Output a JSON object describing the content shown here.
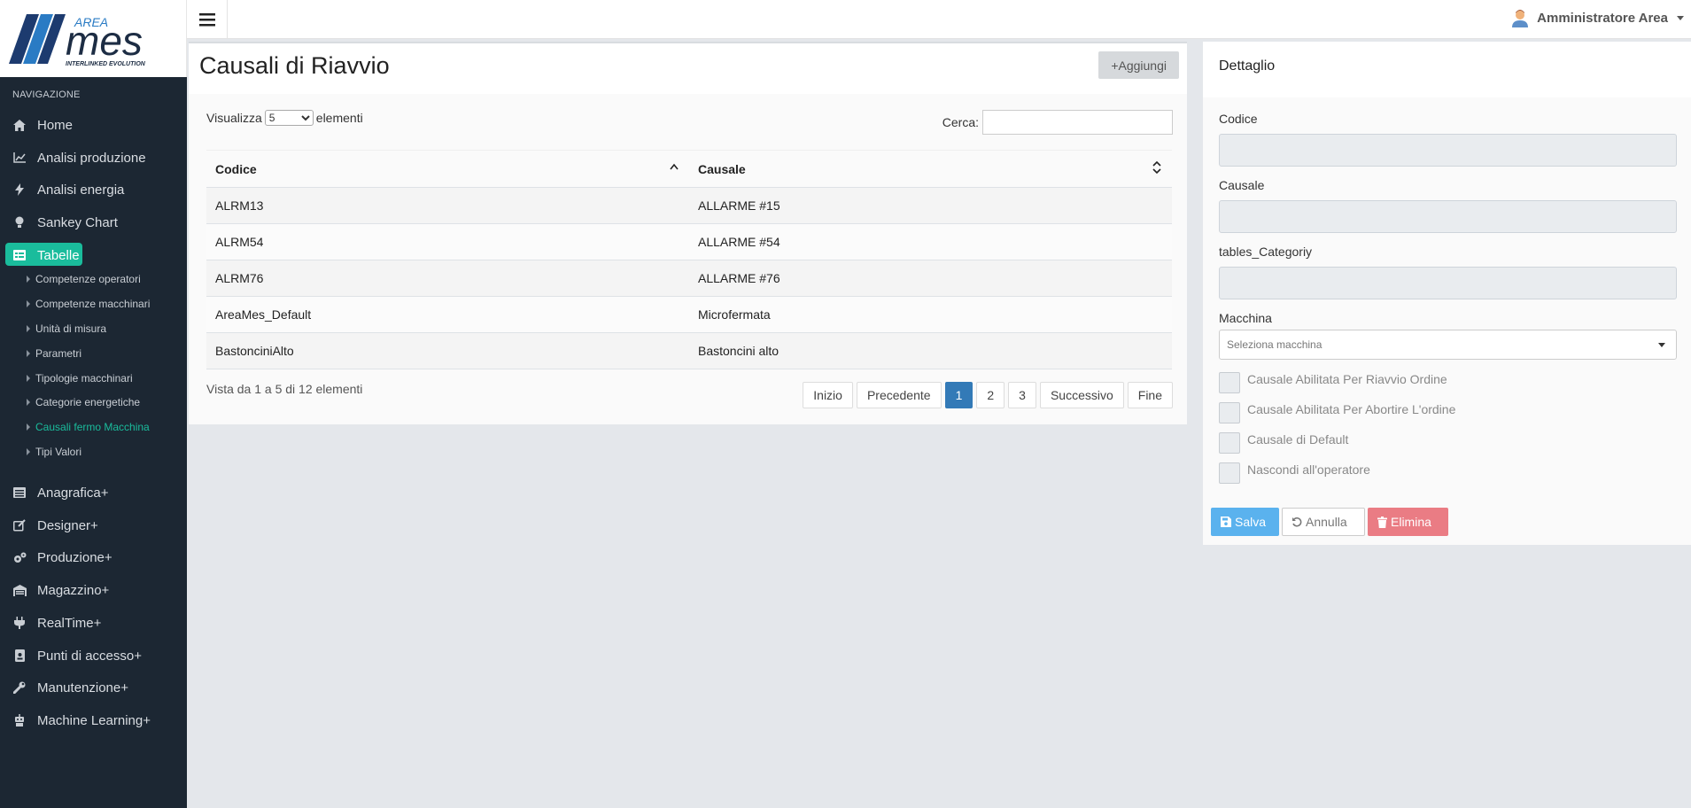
{
  "brand": {
    "logo_small": "AREA",
    "logo_main": "mes",
    "logo_tagline": "INTERLINKED EVOLUTION"
  },
  "sidebar": {
    "section_title": "NAVIGAZIONE",
    "items": [
      {
        "label": "Home",
        "icon": "home-icon"
      },
      {
        "label": "Analisi produzione",
        "icon": "line-chart-icon"
      },
      {
        "label": "Analisi energia",
        "icon": "bolt-icon"
      },
      {
        "label": "Sankey Chart",
        "icon": "lightbulb-icon"
      },
      {
        "label": "Tabelle",
        "icon": "table-icon",
        "active": true
      },
      {
        "label": "Anagrafica+",
        "icon": "list-icon"
      },
      {
        "label": "Designer+",
        "icon": "edit-icon"
      },
      {
        "label": "Produzione+",
        "icon": "cogs-icon"
      },
      {
        "label": "Magazzino+",
        "icon": "warehouse-icon"
      },
      {
        "label": "RealTime+",
        "icon": "plug-icon"
      },
      {
        "label": "Punti di accesso+",
        "icon": "id-badge-icon"
      },
      {
        "label": "Manutenzione+",
        "icon": "wrench-icon"
      },
      {
        "label": "Machine Learning+",
        "icon": "robot-icon"
      }
    ],
    "subitems": [
      {
        "label": "Competenze operatori"
      },
      {
        "label": "Competenze macchinari"
      },
      {
        "label": "Unità di misura"
      },
      {
        "label": "Parametri"
      },
      {
        "label": "Tipologie macchinari"
      },
      {
        "label": "Categorie energetiche"
      },
      {
        "label": "Causali fermo Macchina",
        "active": true
      },
      {
        "label": "Tipi Valori"
      }
    ]
  },
  "topbar": {
    "user_name": "Amministratore Area"
  },
  "main": {
    "title": "Causali di Riavvio",
    "add_button": "+Aggiungi",
    "length_prefix": "Visualizza",
    "length_value": "5",
    "length_suffix": "elementi",
    "search_label": "Cerca:",
    "search_value": "",
    "columns": [
      "Codice",
      "Causale"
    ],
    "rows": [
      [
        "ALRM13",
        "ALLARME #15"
      ],
      [
        "ALRM54",
        "ALLARME #54"
      ],
      [
        "ALRM76",
        "ALLARME #76"
      ],
      [
        "AreaMes_Default",
        "Microfermata"
      ],
      [
        "BastonciniAlto",
        "Bastoncini alto"
      ]
    ],
    "info": "Vista da 1 a 5 di 12 elementi",
    "pager": [
      "Inizio",
      "Precedente",
      "1",
      "2",
      "3",
      "Successivo",
      "Fine"
    ],
    "current_page": "1"
  },
  "detail": {
    "title": "Dettaglio",
    "fields": {
      "codice_label": "Codice",
      "causale_label": "Causale",
      "category_label": "tables_Categoriy",
      "machine_label": "Macchina",
      "machine_placeholder": "Seleziona macchina"
    },
    "checkboxes": [
      {
        "label": "Causale Abilitata Per Riavvio Ordine",
        "checked": false
      },
      {
        "label": "Causale Abilitata Per Abortire L'ordine",
        "checked": false
      },
      {
        "label": "Causale di Default",
        "checked": false
      },
      {
        "label": "Nascondi all'operatore",
        "checked": false
      }
    ],
    "buttons": {
      "save": "Salva",
      "cancel": "Annulla",
      "delete": "Elimina"
    }
  },
  "colors": {
    "sidebar_bg": "#1c2733",
    "accent": "#1abc9c",
    "primary": "#337ab7",
    "save": "#5ab2ee",
    "delete": "#ea7c84"
  }
}
